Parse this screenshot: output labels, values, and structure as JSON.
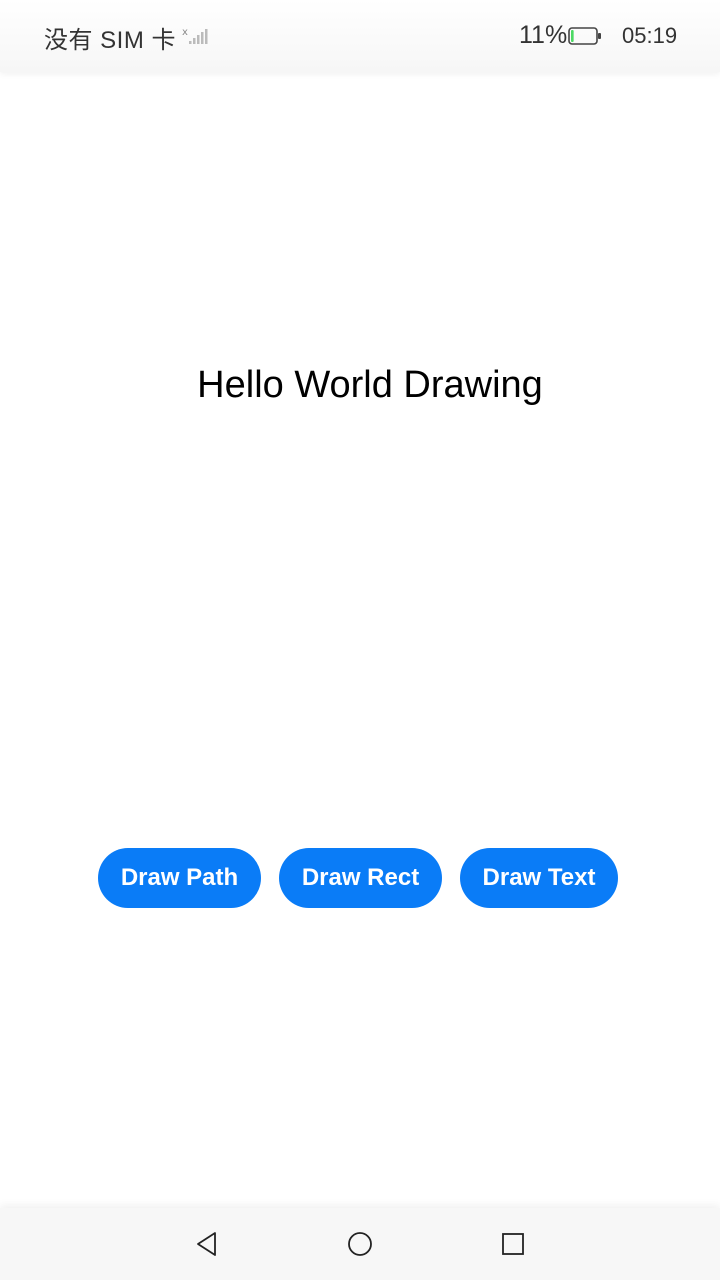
{
  "status_bar": {
    "carrier": "没有 SIM 卡",
    "battery_percent": "11%",
    "battery_level": 0.11,
    "battery_color": "#4cd964",
    "time": "05:19",
    "icons": [
      "signal-icon",
      "battery-icon"
    ]
  },
  "canvas": {
    "text": "Hello World Drawing"
  },
  "buttons": {
    "draw_path": "Draw Path",
    "draw_rect": "Draw Rect",
    "draw_text": "Draw Text",
    "color": "#0a7cf7"
  },
  "nav_bar": {
    "icons": [
      "back-icon",
      "home-icon",
      "recent-apps-icon"
    ]
  }
}
